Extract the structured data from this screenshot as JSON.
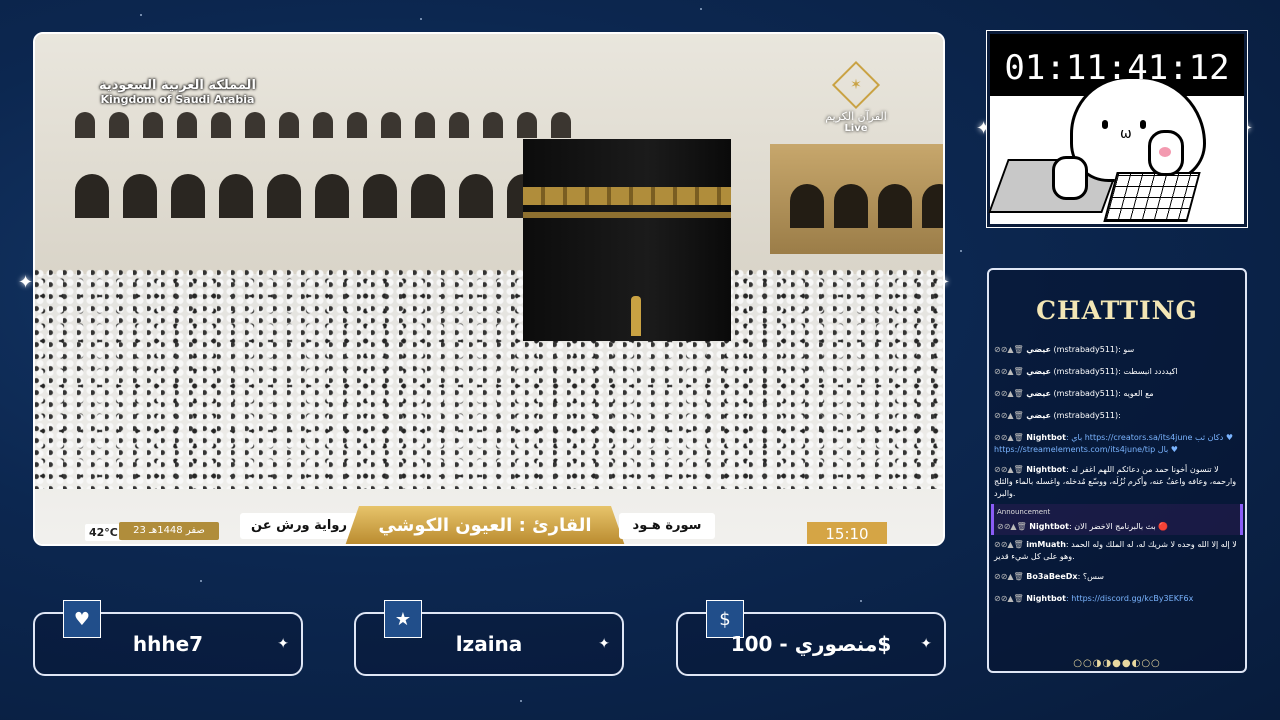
{
  "stream": {
    "broadcast_country_ar": "المملكة العربية السعودية",
    "broadcast_country_en": "Kingdom of Saudi Arabia",
    "channel_ar": "القرآن الكريم",
    "live_label": "Live",
    "temperature": "42°C",
    "hijri_date": "23 صفر 1448هـ",
    "riwaya": "رواية ورش عن نافع",
    "reciter": "القارئ : العيون الكوشي",
    "surah": "سورة هـود",
    "time": "15:10"
  },
  "timer": {
    "value": "01:11:41:12"
  },
  "chat": {
    "title": "CHATTING",
    "messages": [
      {
        "user": "عيضي",
        "handle": "(mstrabady511)",
        "text": ": سو"
      },
      {
        "user": "عيضي",
        "handle": "(mstrabady511)",
        "text": ": اكيدددد انبسطت"
      },
      {
        "user": "عيضي",
        "handle": "(mstrabady511)",
        "text": ": مع العويه"
      },
      {
        "user": "عيضي",
        "handle": "(mstrabady511)",
        "text": ":"
      },
      {
        "user": "Nightbot",
        "handle": "",
        "text": ": باي https://creators.sa/its4june دكان ثب ♥ https://streamelements.com/its4june/tip بال ♥"
      },
      {
        "user": "Nightbot",
        "handle": "",
        "text": ": لا تنسون أخونا حمد من دعائكم اللهم اغفر له وارحمه، وعافه واعفُ عنه، وأكرم نُزُلَه، ووسّع مُدخله، واغسله بالماء والثلج والبرد."
      },
      {
        "user": "Nightbot",
        "handle": "",
        "text": ": بث بالبرنامج الاخضر الان 🔴",
        "announcement": "Announcement"
      },
      {
        "user": "imMuath",
        "handle": "",
        "text": ": لا إله إلا الله وحده لا شريك له، له الملك وله الحمد وهو على كل شيء قدير."
      },
      {
        "user": "Bo3aBeeDx",
        "handle": "",
        "text": ": سس؟"
      },
      {
        "user": "Nightbot",
        "handle": "",
        "text": ": https://discord.gg/kcBy3EKF6x"
      }
    ],
    "pager": "○○◑◑●●◐○○"
  },
  "bottom": [
    {
      "icon": "heart-icon",
      "glyph": "♥",
      "text": "hhhe7"
    },
    {
      "icon": "star-icon",
      "glyph": "★",
      "text": "lzaina"
    },
    {
      "icon": "dollar-icon",
      "glyph": "$",
      "text": "منصوري - 100$"
    }
  ],
  "colors": {
    "accent_gold": "#d5a545",
    "background": "#0c2750",
    "chat_title": "#f3e6b5"
  }
}
